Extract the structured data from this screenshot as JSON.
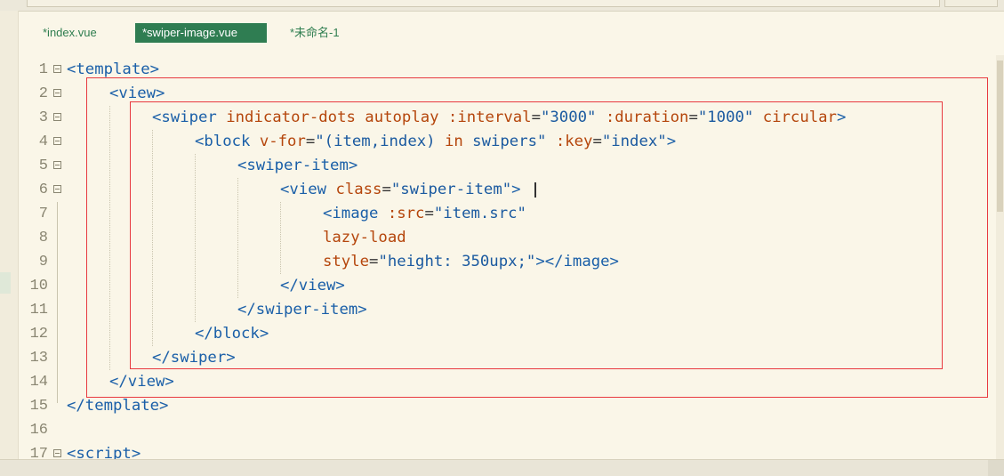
{
  "tabs": [
    {
      "label": "*index.vue",
      "active": false
    },
    {
      "label": "*swiper-image.vue",
      "active": true
    },
    {
      "label": "*未命名-1",
      "active": false
    }
  ],
  "colors": {
    "tag": "#1a5fa8",
    "attr": "#b5460c",
    "string": "#1b5aa0",
    "text": "#333333",
    "highlight_box": "#e8393f",
    "active_tab": "#2f7d52"
  },
  "editor": {
    "lines": [
      {
        "num": "1",
        "fold": true,
        "indent": 0,
        "tokens": [
          [
            "tag",
            "<template>"
          ]
        ]
      },
      {
        "num": "2",
        "fold": true,
        "indent": 1,
        "tokens": [
          [
            "tag",
            "<view>"
          ]
        ]
      },
      {
        "num": "3",
        "fold": true,
        "indent": 2,
        "tokens": [
          [
            "tag",
            "<swiper "
          ],
          [
            "attr",
            "indicator-dots autoplay :interval"
          ],
          [
            "text",
            "="
          ],
          [
            "string",
            "\"3000\" "
          ],
          [
            "attr",
            ":duration"
          ],
          [
            "text",
            "="
          ],
          [
            "string",
            "\"1000\" "
          ],
          [
            "attr",
            "circular"
          ],
          [
            "tag",
            ">"
          ]
        ]
      },
      {
        "num": "4",
        "fold": true,
        "indent": 3,
        "tokens": [
          [
            "tag",
            "<block "
          ],
          [
            "attr",
            "v-for"
          ],
          [
            "text",
            "="
          ],
          [
            "string",
            "\"(item,index) "
          ],
          [
            "attr",
            "in"
          ],
          [
            "string",
            " swipers\" "
          ],
          [
            "attr",
            ":key"
          ],
          [
            "text",
            "="
          ],
          [
            "string",
            "\"index\""
          ],
          [
            "tag",
            ">"
          ]
        ]
      },
      {
        "num": "5",
        "fold": true,
        "indent": 4,
        "tokens": [
          [
            "tag",
            "<swiper-item>"
          ]
        ]
      },
      {
        "num": "6",
        "fold": true,
        "indent": 5,
        "tokens": [
          [
            "tag",
            "<view "
          ],
          [
            "attr",
            "class"
          ],
          [
            "text",
            "="
          ],
          [
            "string",
            "\"swiper-item\""
          ],
          [
            "tag",
            ">"
          ]
        ]
      },
      {
        "num": "7",
        "fold": false,
        "indent": 6,
        "tokens": [
          [
            "tag",
            "<image "
          ],
          [
            "attr",
            ":src"
          ],
          [
            "text",
            "="
          ],
          [
            "string",
            "\"item.src\""
          ]
        ]
      },
      {
        "num": "8",
        "fold": false,
        "indent": 6,
        "tokens": [
          [
            "attr",
            "lazy-load"
          ]
        ]
      },
      {
        "num": "9",
        "fold": false,
        "indent": 6,
        "tokens": [
          [
            "attr",
            "style"
          ],
          [
            "text",
            "="
          ],
          [
            "string",
            "\"height: 350upx;\""
          ],
          [
            "tag",
            "></image>"
          ]
        ]
      },
      {
        "num": "10",
        "fold": false,
        "indent": 5,
        "tokens": [
          [
            "tag",
            "</view>"
          ]
        ]
      },
      {
        "num": "11",
        "fold": false,
        "indent": 4,
        "tokens": [
          [
            "tag",
            "</swiper-item>"
          ]
        ]
      },
      {
        "num": "12",
        "fold": false,
        "indent": 3,
        "tokens": [
          [
            "tag",
            "</block>"
          ]
        ]
      },
      {
        "num": "13",
        "fold": false,
        "indent": 2,
        "tokens": [
          [
            "tag",
            "</swiper>"
          ]
        ]
      },
      {
        "num": "14",
        "fold": false,
        "indent": 1,
        "tokens": [
          [
            "tag",
            "</view>"
          ]
        ]
      },
      {
        "num": "15",
        "fold": false,
        "indent": 0,
        "tokens": [
          [
            "tag",
            "</template>"
          ]
        ]
      },
      {
        "num": "16",
        "fold": false,
        "indent": 0,
        "tokens": []
      },
      {
        "num": "17",
        "fold": true,
        "indent": 0,
        "tokens": [
          [
            "tag",
            "<script>"
          ]
        ]
      }
    ]
  }
}
